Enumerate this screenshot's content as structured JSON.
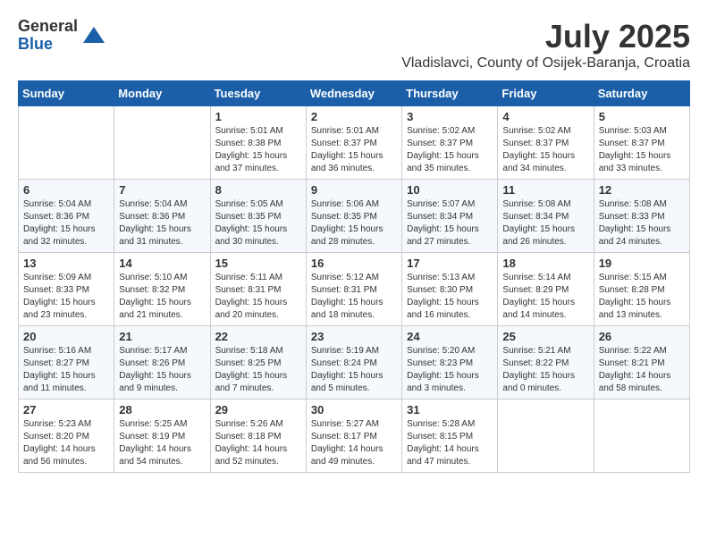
{
  "logo": {
    "general": "General",
    "blue": "Blue"
  },
  "title": {
    "month": "July 2025",
    "location": "Vladislavci, County of Osijek-Baranja, Croatia"
  },
  "weekdays": [
    "Sunday",
    "Monday",
    "Tuesday",
    "Wednesday",
    "Thursday",
    "Friday",
    "Saturday"
  ],
  "weeks": [
    [
      {
        "day": "",
        "sunrise": "",
        "sunset": "",
        "daylight": ""
      },
      {
        "day": "",
        "sunrise": "",
        "sunset": "",
        "daylight": ""
      },
      {
        "day": "1",
        "sunrise": "Sunrise: 5:01 AM",
        "sunset": "Sunset: 8:38 PM",
        "daylight": "Daylight: 15 hours and 37 minutes."
      },
      {
        "day": "2",
        "sunrise": "Sunrise: 5:01 AM",
        "sunset": "Sunset: 8:37 PM",
        "daylight": "Daylight: 15 hours and 36 minutes."
      },
      {
        "day": "3",
        "sunrise": "Sunrise: 5:02 AM",
        "sunset": "Sunset: 8:37 PM",
        "daylight": "Daylight: 15 hours and 35 minutes."
      },
      {
        "day": "4",
        "sunrise": "Sunrise: 5:02 AM",
        "sunset": "Sunset: 8:37 PM",
        "daylight": "Daylight: 15 hours and 34 minutes."
      },
      {
        "day": "5",
        "sunrise": "Sunrise: 5:03 AM",
        "sunset": "Sunset: 8:37 PM",
        "daylight": "Daylight: 15 hours and 33 minutes."
      }
    ],
    [
      {
        "day": "6",
        "sunrise": "Sunrise: 5:04 AM",
        "sunset": "Sunset: 8:36 PM",
        "daylight": "Daylight: 15 hours and 32 minutes."
      },
      {
        "day": "7",
        "sunrise": "Sunrise: 5:04 AM",
        "sunset": "Sunset: 8:36 PM",
        "daylight": "Daylight: 15 hours and 31 minutes."
      },
      {
        "day": "8",
        "sunrise": "Sunrise: 5:05 AM",
        "sunset": "Sunset: 8:35 PM",
        "daylight": "Daylight: 15 hours and 30 minutes."
      },
      {
        "day": "9",
        "sunrise": "Sunrise: 5:06 AM",
        "sunset": "Sunset: 8:35 PM",
        "daylight": "Daylight: 15 hours and 28 minutes."
      },
      {
        "day": "10",
        "sunrise": "Sunrise: 5:07 AM",
        "sunset": "Sunset: 8:34 PM",
        "daylight": "Daylight: 15 hours and 27 minutes."
      },
      {
        "day": "11",
        "sunrise": "Sunrise: 5:08 AM",
        "sunset": "Sunset: 8:34 PM",
        "daylight": "Daylight: 15 hours and 26 minutes."
      },
      {
        "day": "12",
        "sunrise": "Sunrise: 5:08 AM",
        "sunset": "Sunset: 8:33 PM",
        "daylight": "Daylight: 15 hours and 24 minutes."
      }
    ],
    [
      {
        "day": "13",
        "sunrise": "Sunrise: 5:09 AM",
        "sunset": "Sunset: 8:33 PM",
        "daylight": "Daylight: 15 hours and 23 minutes."
      },
      {
        "day": "14",
        "sunrise": "Sunrise: 5:10 AM",
        "sunset": "Sunset: 8:32 PM",
        "daylight": "Daylight: 15 hours and 21 minutes."
      },
      {
        "day": "15",
        "sunrise": "Sunrise: 5:11 AM",
        "sunset": "Sunset: 8:31 PM",
        "daylight": "Daylight: 15 hours and 20 minutes."
      },
      {
        "day": "16",
        "sunrise": "Sunrise: 5:12 AM",
        "sunset": "Sunset: 8:31 PM",
        "daylight": "Daylight: 15 hours and 18 minutes."
      },
      {
        "day": "17",
        "sunrise": "Sunrise: 5:13 AM",
        "sunset": "Sunset: 8:30 PM",
        "daylight": "Daylight: 15 hours and 16 minutes."
      },
      {
        "day": "18",
        "sunrise": "Sunrise: 5:14 AM",
        "sunset": "Sunset: 8:29 PM",
        "daylight": "Daylight: 15 hours and 14 minutes."
      },
      {
        "day": "19",
        "sunrise": "Sunrise: 5:15 AM",
        "sunset": "Sunset: 8:28 PM",
        "daylight": "Daylight: 15 hours and 13 minutes."
      }
    ],
    [
      {
        "day": "20",
        "sunrise": "Sunrise: 5:16 AM",
        "sunset": "Sunset: 8:27 PM",
        "daylight": "Daylight: 15 hours and 11 minutes."
      },
      {
        "day": "21",
        "sunrise": "Sunrise: 5:17 AM",
        "sunset": "Sunset: 8:26 PM",
        "daylight": "Daylight: 15 hours and 9 minutes."
      },
      {
        "day": "22",
        "sunrise": "Sunrise: 5:18 AM",
        "sunset": "Sunset: 8:25 PM",
        "daylight": "Daylight: 15 hours and 7 minutes."
      },
      {
        "day": "23",
        "sunrise": "Sunrise: 5:19 AM",
        "sunset": "Sunset: 8:24 PM",
        "daylight": "Daylight: 15 hours and 5 minutes."
      },
      {
        "day": "24",
        "sunrise": "Sunrise: 5:20 AM",
        "sunset": "Sunset: 8:23 PM",
        "daylight": "Daylight: 15 hours and 3 minutes."
      },
      {
        "day": "25",
        "sunrise": "Sunrise: 5:21 AM",
        "sunset": "Sunset: 8:22 PM",
        "daylight": "Daylight: 15 hours and 0 minutes."
      },
      {
        "day": "26",
        "sunrise": "Sunrise: 5:22 AM",
        "sunset": "Sunset: 8:21 PM",
        "daylight": "Daylight: 14 hours and 58 minutes."
      }
    ],
    [
      {
        "day": "27",
        "sunrise": "Sunrise: 5:23 AM",
        "sunset": "Sunset: 8:20 PM",
        "daylight": "Daylight: 14 hours and 56 minutes."
      },
      {
        "day": "28",
        "sunrise": "Sunrise: 5:25 AM",
        "sunset": "Sunset: 8:19 PM",
        "daylight": "Daylight: 14 hours and 54 minutes."
      },
      {
        "day": "29",
        "sunrise": "Sunrise: 5:26 AM",
        "sunset": "Sunset: 8:18 PM",
        "daylight": "Daylight: 14 hours and 52 minutes."
      },
      {
        "day": "30",
        "sunrise": "Sunrise: 5:27 AM",
        "sunset": "Sunset: 8:17 PM",
        "daylight": "Daylight: 14 hours and 49 minutes."
      },
      {
        "day": "31",
        "sunrise": "Sunrise: 5:28 AM",
        "sunset": "Sunset: 8:15 PM",
        "daylight": "Daylight: 14 hours and 47 minutes."
      },
      {
        "day": "",
        "sunrise": "",
        "sunset": "",
        "daylight": ""
      },
      {
        "day": "",
        "sunrise": "",
        "sunset": "",
        "daylight": ""
      }
    ]
  ]
}
